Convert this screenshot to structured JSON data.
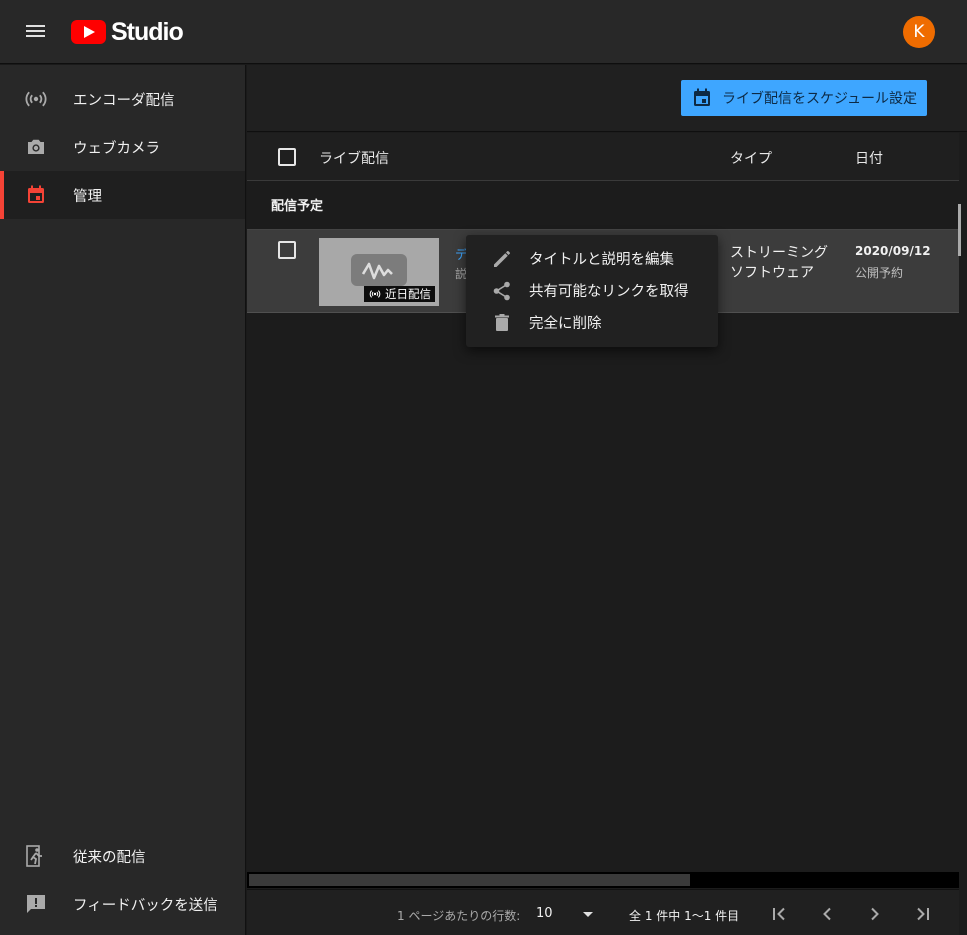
{
  "app": {
    "logo_text": "Studio",
    "avatar_initial": "K",
    "accent_color": "#3ea6ff",
    "active_color": "#f44336"
  },
  "sidebar": {
    "items": [
      {
        "label": "エンコーダ配信",
        "icon": "live-broadcast-icon"
      },
      {
        "label": "ウェブカメラ",
        "icon": "camera-icon"
      },
      {
        "label": "管理",
        "icon": "calendar-icon",
        "active": true
      }
    ],
    "bottom_items": [
      {
        "label": "従来の配信",
        "icon": "exit-icon"
      },
      {
        "label": "フィードバックを送信",
        "icon": "feedback-icon"
      }
    ]
  },
  "toolbar": {
    "schedule_label": "ライブ配信をスケジュール設定"
  },
  "table": {
    "columns": {
      "title": "ライブ配信",
      "type": "タイプ",
      "date": "日付"
    },
    "section": "配信予定",
    "rows": [
      {
        "title_peek": "デ",
        "desc_peek": "説",
        "badge": "近日配信",
        "type_line1": "ストリーミング",
        "type_line2": "ソフトウェア",
        "date": "2020/09/12",
        "status": "公開予約"
      }
    ]
  },
  "context_menu": {
    "items": [
      {
        "label": "タイトルと説明を編集",
        "icon": "pencil-icon"
      },
      {
        "label": "共有可能なリンクを取得",
        "icon": "share-icon"
      },
      {
        "label": "完全に削除",
        "icon": "trash-icon"
      }
    ]
  },
  "footer": {
    "rows_per_page_label": "1 ページあたりの行数:",
    "rows_per_page_value": "10",
    "range_text": "全 1 件中 1〜1 件目"
  }
}
